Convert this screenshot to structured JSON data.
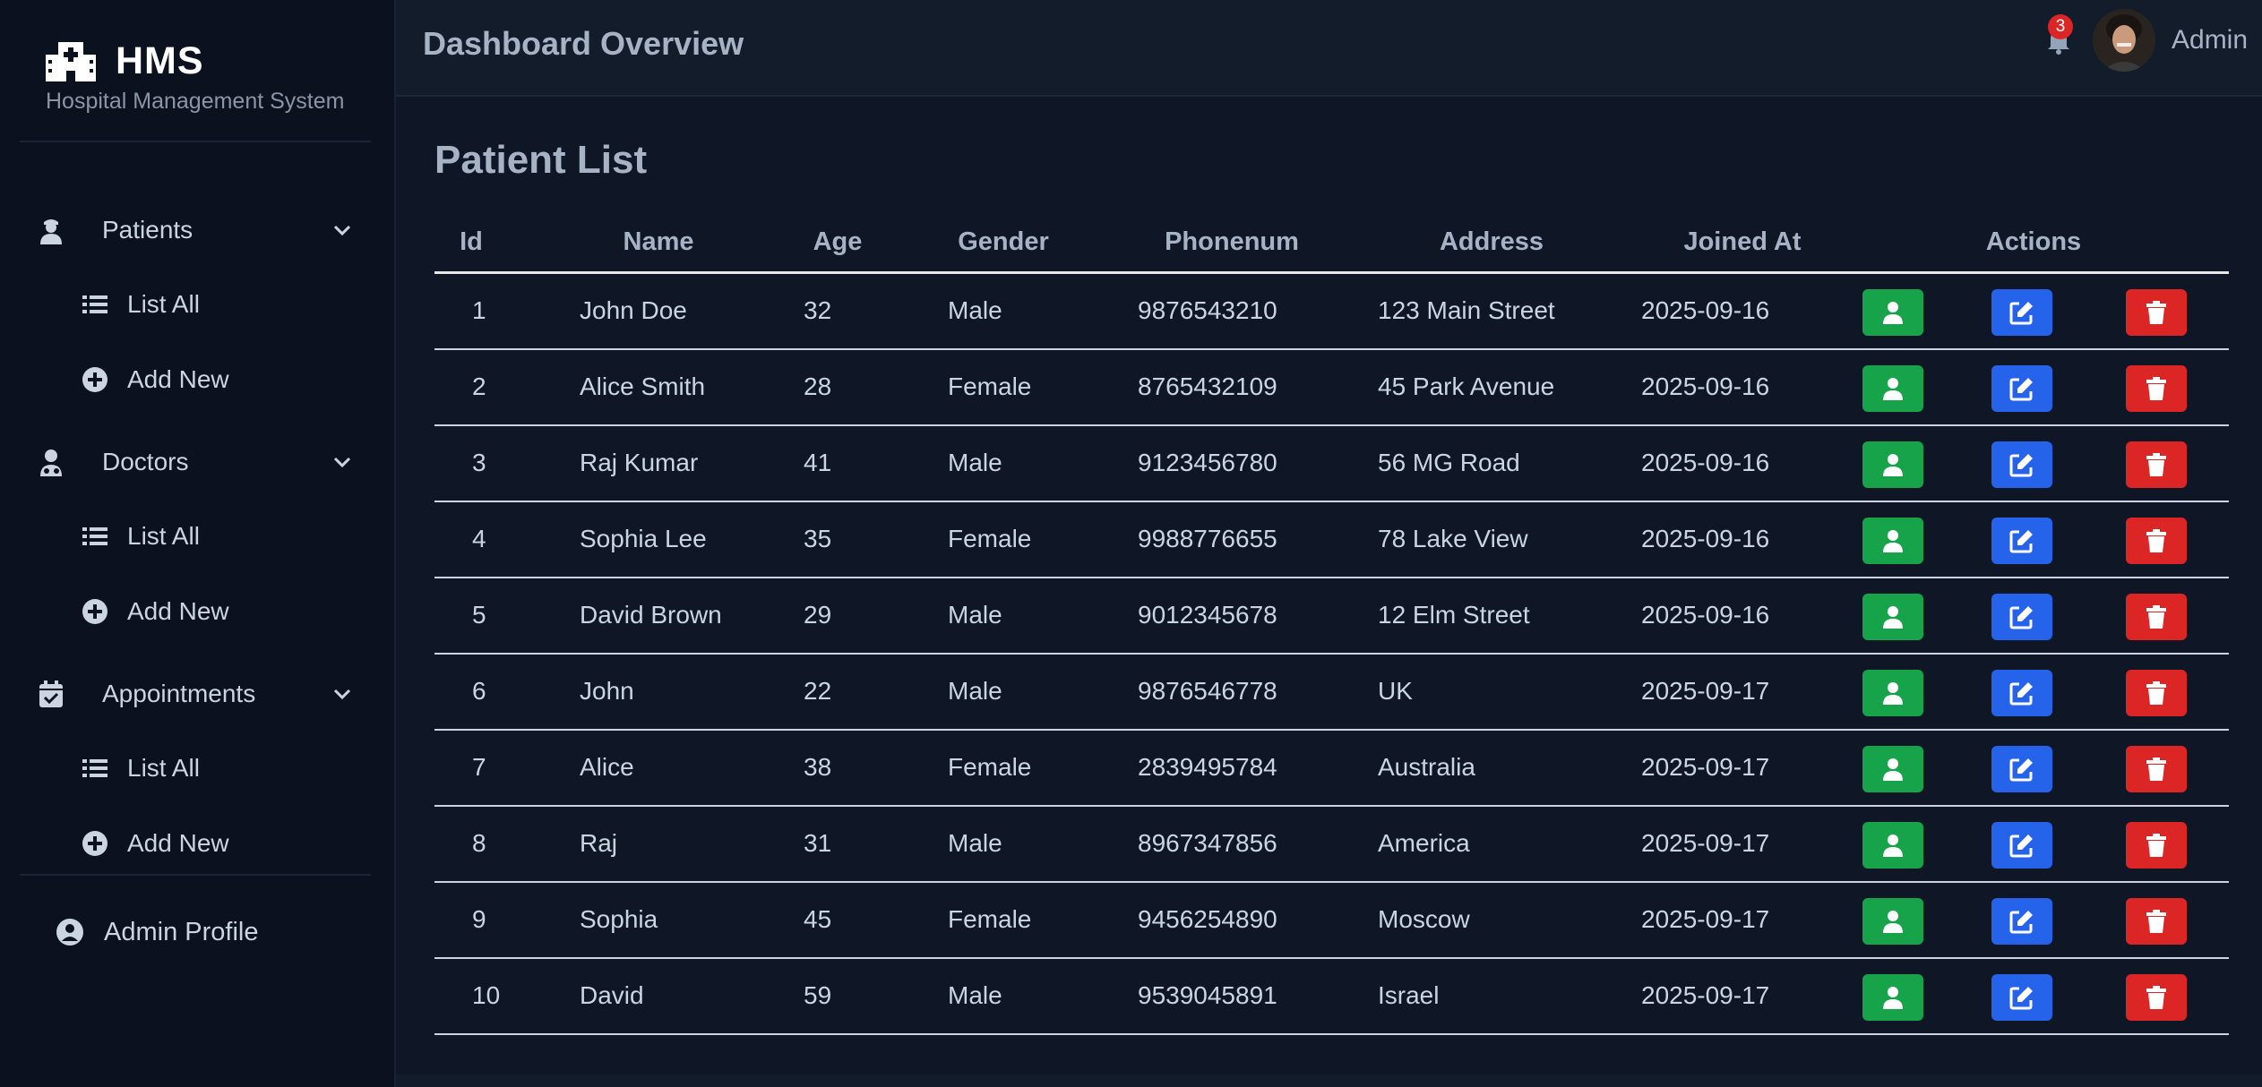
{
  "sidebar": {
    "brand_title": "HMS",
    "brand_subtitle": "Hospital Management System",
    "sections": [
      {
        "label": "Patients",
        "icon": "patient-icon",
        "items": [
          {
            "label": "List All",
            "icon": "list-icon"
          },
          {
            "label": "Add New",
            "icon": "plus-circle-icon"
          }
        ]
      },
      {
        "label": "Doctors",
        "icon": "doctor-icon",
        "items": [
          {
            "label": "List All",
            "icon": "list-icon"
          },
          {
            "label": "Add New",
            "icon": "plus-circle-icon"
          }
        ]
      },
      {
        "label": "Appointments",
        "icon": "calendar-check-icon",
        "items": [
          {
            "label": "List All",
            "icon": "list-icon"
          },
          {
            "label": "Add New",
            "icon": "plus-circle-icon"
          }
        ]
      }
    ],
    "profile_label": "Admin Profile"
  },
  "header": {
    "title": "Dashboard Overview",
    "notification_count": "3",
    "user_name": "Admin"
  },
  "main": {
    "title": "Patient List",
    "columns": [
      "Id",
      "Name",
      "Age",
      "Gender",
      "Phonenum",
      "Address",
      "Joined At",
      "Actions"
    ],
    "rows": [
      {
        "id": "1",
        "name": "John Doe",
        "age": "32",
        "gender": "Male",
        "phone": "9876543210",
        "address": "123 Main Street",
        "joined": "2025-09-16"
      },
      {
        "id": "2",
        "name": "Alice Smith",
        "age": "28",
        "gender": "Female",
        "phone": "8765432109",
        "address": "45 Park Avenue",
        "joined": "2025-09-16"
      },
      {
        "id": "3",
        "name": "Raj Kumar",
        "age": "41",
        "gender": "Male",
        "phone": "9123456780",
        "address": "56 MG Road",
        "joined": "2025-09-16"
      },
      {
        "id": "4",
        "name": "Sophia Lee",
        "age": "35",
        "gender": "Female",
        "phone": "9988776655",
        "address": "78 Lake View",
        "joined": "2025-09-16"
      },
      {
        "id": "5",
        "name": "David Brown",
        "age": "29",
        "gender": "Male",
        "phone": "9012345678",
        "address": "12 Elm Street",
        "joined": "2025-09-16"
      },
      {
        "id": "6",
        "name": "John",
        "age": "22",
        "gender": "Male",
        "phone": "9876546778",
        "address": "UK",
        "joined": "2025-09-17"
      },
      {
        "id": "7",
        "name": "Alice",
        "age": "38",
        "gender": "Female",
        "phone": "2839495784",
        "address": "Australia",
        "joined": "2025-09-17"
      },
      {
        "id": "8",
        "name": "Raj",
        "age": "31",
        "gender": "Male",
        "phone": "8967347856",
        "address": "America",
        "joined": "2025-09-17"
      },
      {
        "id": "9",
        "name": "Sophia",
        "age": "45",
        "gender": "Female",
        "phone": "9456254890",
        "address": "Moscow",
        "joined": "2025-09-17"
      },
      {
        "id": "10",
        "name": "David",
        "age": "59",
        "gender": "Male",
        "phone": "9539045891",
        "address": "Israel",
        "joined": "2025-09-17"
      }
    ],
    "action_icons": [
      "user-icon",
      "edit-icon",
      "trash-icon"
    ]
  },
  "colors": {
    "sidebar_bg": "#0b111e",
    "main_bg": "#0f1726",
    "header_bg": "#131c2b",
    "view_button": "#16a34a",
    "edit_button": "#2563eb",
    "delete_button": "#dc2626",
    "badge": "#dc2626"
  }
}
